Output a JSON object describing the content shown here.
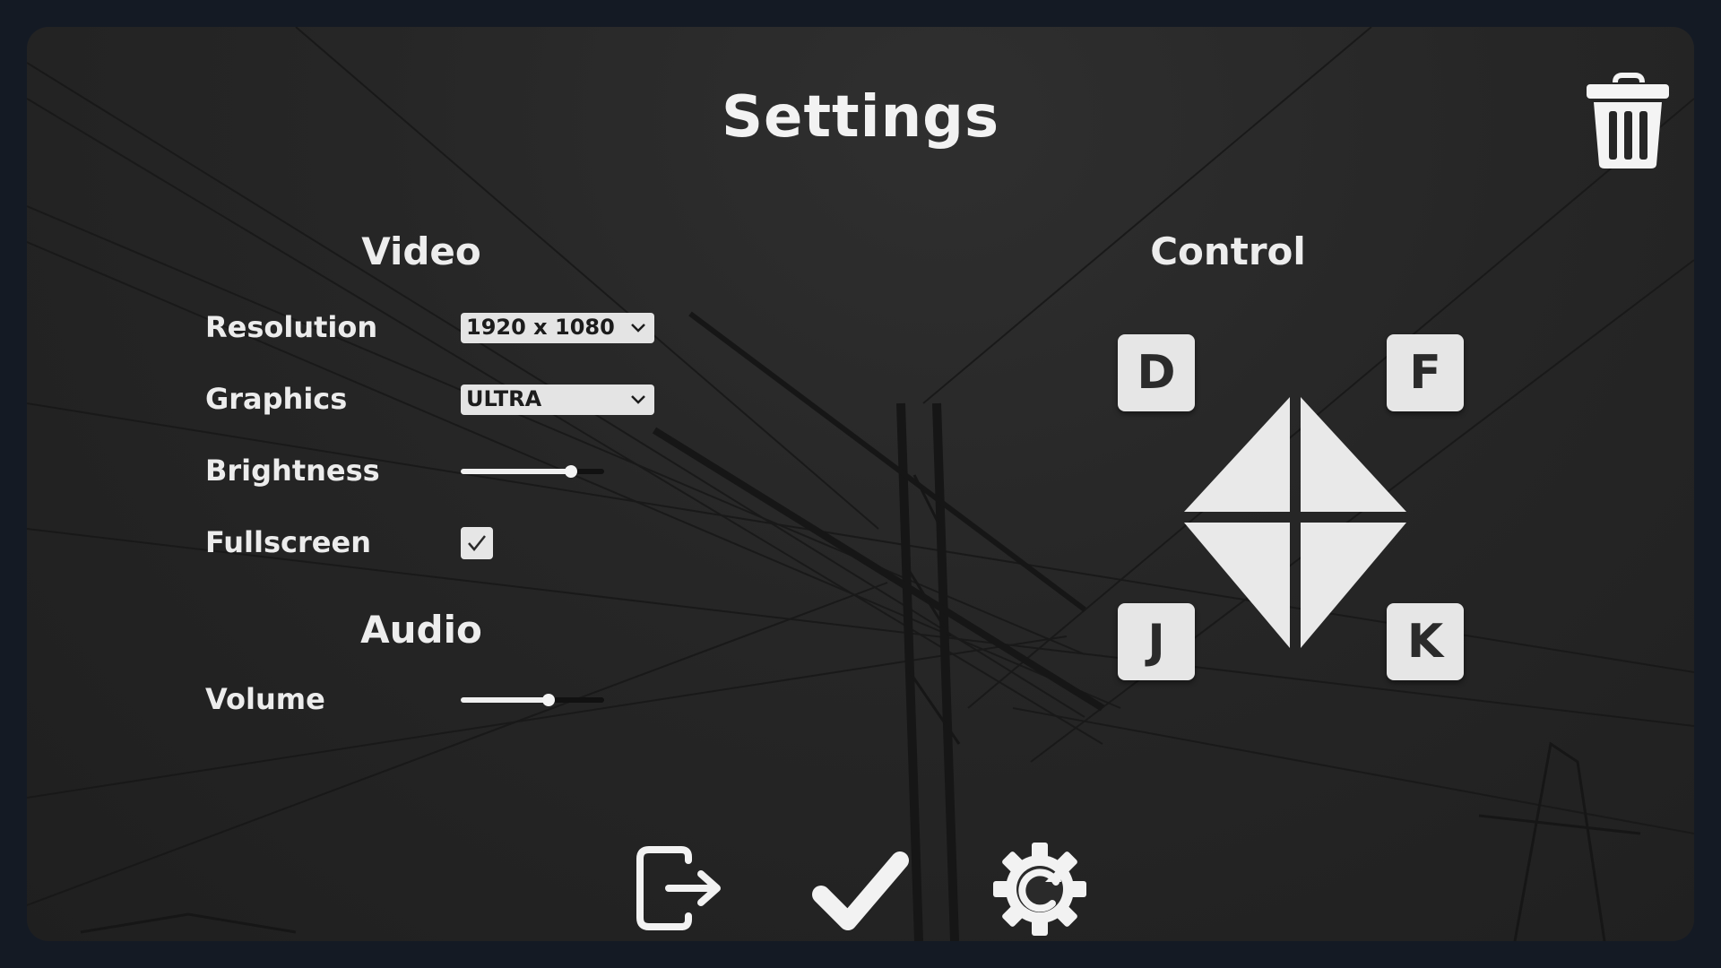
{
  "title": "Settings",
  "video": {
    "title": "Video",
    "resolution": {
      "label": "Resolution",
      "value": "1920 x 1080"
    },
    "graphics": {
      "label": "Graphics",
      "value": "ULTRA"
    },
    "brightness": {
      "label": "Brightness",
      "level": 0.77
    },
    "fullscreen": {
      "label": "Fullscreen",
      "checked": true
    }
  },
  "audio": {
    "title": "Audio",
    "volume": {
      "label": "Volume",
      "level": 0.61
    }
  },
  "control": {
    "title": "Control",
    "keys": {
      "up_left": "D",
      "up_right": "F",
      "down_left": "J",
      "down_right": "K"
    }
  },
  "icons": {
    "delete": "trash-icon",
    "exit": "exit-icon",
    "apply": "checkmark-icon",
    "reset": "gear-reset-icon",
    "dropdown": "chevron-down-icon",
    "checkbox": "check-icon",
    "dpad": "diamond-dpad-icon"
  },
  "colors": {
    "panel_bg": "#262626",
    "outer_bg": "#141a24",
    "text": "#ececec",
    "control_surface": "#e6e6e6",
    "slider_track": "#111111"
  }
}
